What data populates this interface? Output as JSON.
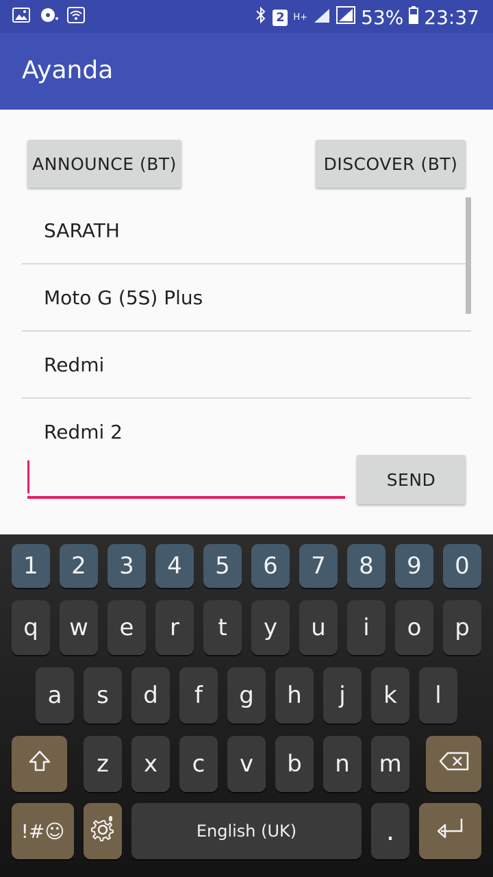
{
  "status_bar": {
    "icons_left": [
      "gallery-icon",
      "media-icon",
      "wifi-icon"
    ],
    "bluetooth": "bluetooth-icon",
    "sim_badge": "2",
    "network": "H+",
    "battery_percent": "53%",
    "time": "23:37"
  },
  "app": {
    "title": "Ayanda"
  },
  "buttons": {
    "announce": "ANNOUNCE (BT)",
    "discover": "DISCOVER (BT)",
    "send": "SEND"
  },
  "devices": [
    "SARATH",
    "Moto G (5S) Plus",
    "Redmi",
    "Redmi 2"
  ],
  "message_input": {
    "value": "",
    "placeholder": ""
  },
  "keyboard": {
    "row_numbers": [
      "1",
      "2",
      "3",
      "4",
      "5",
      "6",
      "7",
      "8",
      "9",
      "0"
    ],
    "row1": [
      "q",
      "w",
      "e",
      "r",
      "t",
      "y",
      "u",
      "i",
      "o",
      "p"
    ],
    "row2": [
      "a",
      "s",
      "d",
      "f",
      "g",
      "h",
      "j",
      "k",
      "l"
    ],
    "row3": [
      "z",
      "x",
      "c",
      "v",
      "b",
      "n",
      "m"
    ],
    "symbols": "!#☺",
    "space_label": "English (UK)",
    "period": "."
  },
  "colors": {
    "status_bar": "#3949ab",
    "app_bar": "#3f51b5",
    "accent": "#e91e63",
    "number_key": "#455a6b",
    "function_key": "#73624a"
  }
}
